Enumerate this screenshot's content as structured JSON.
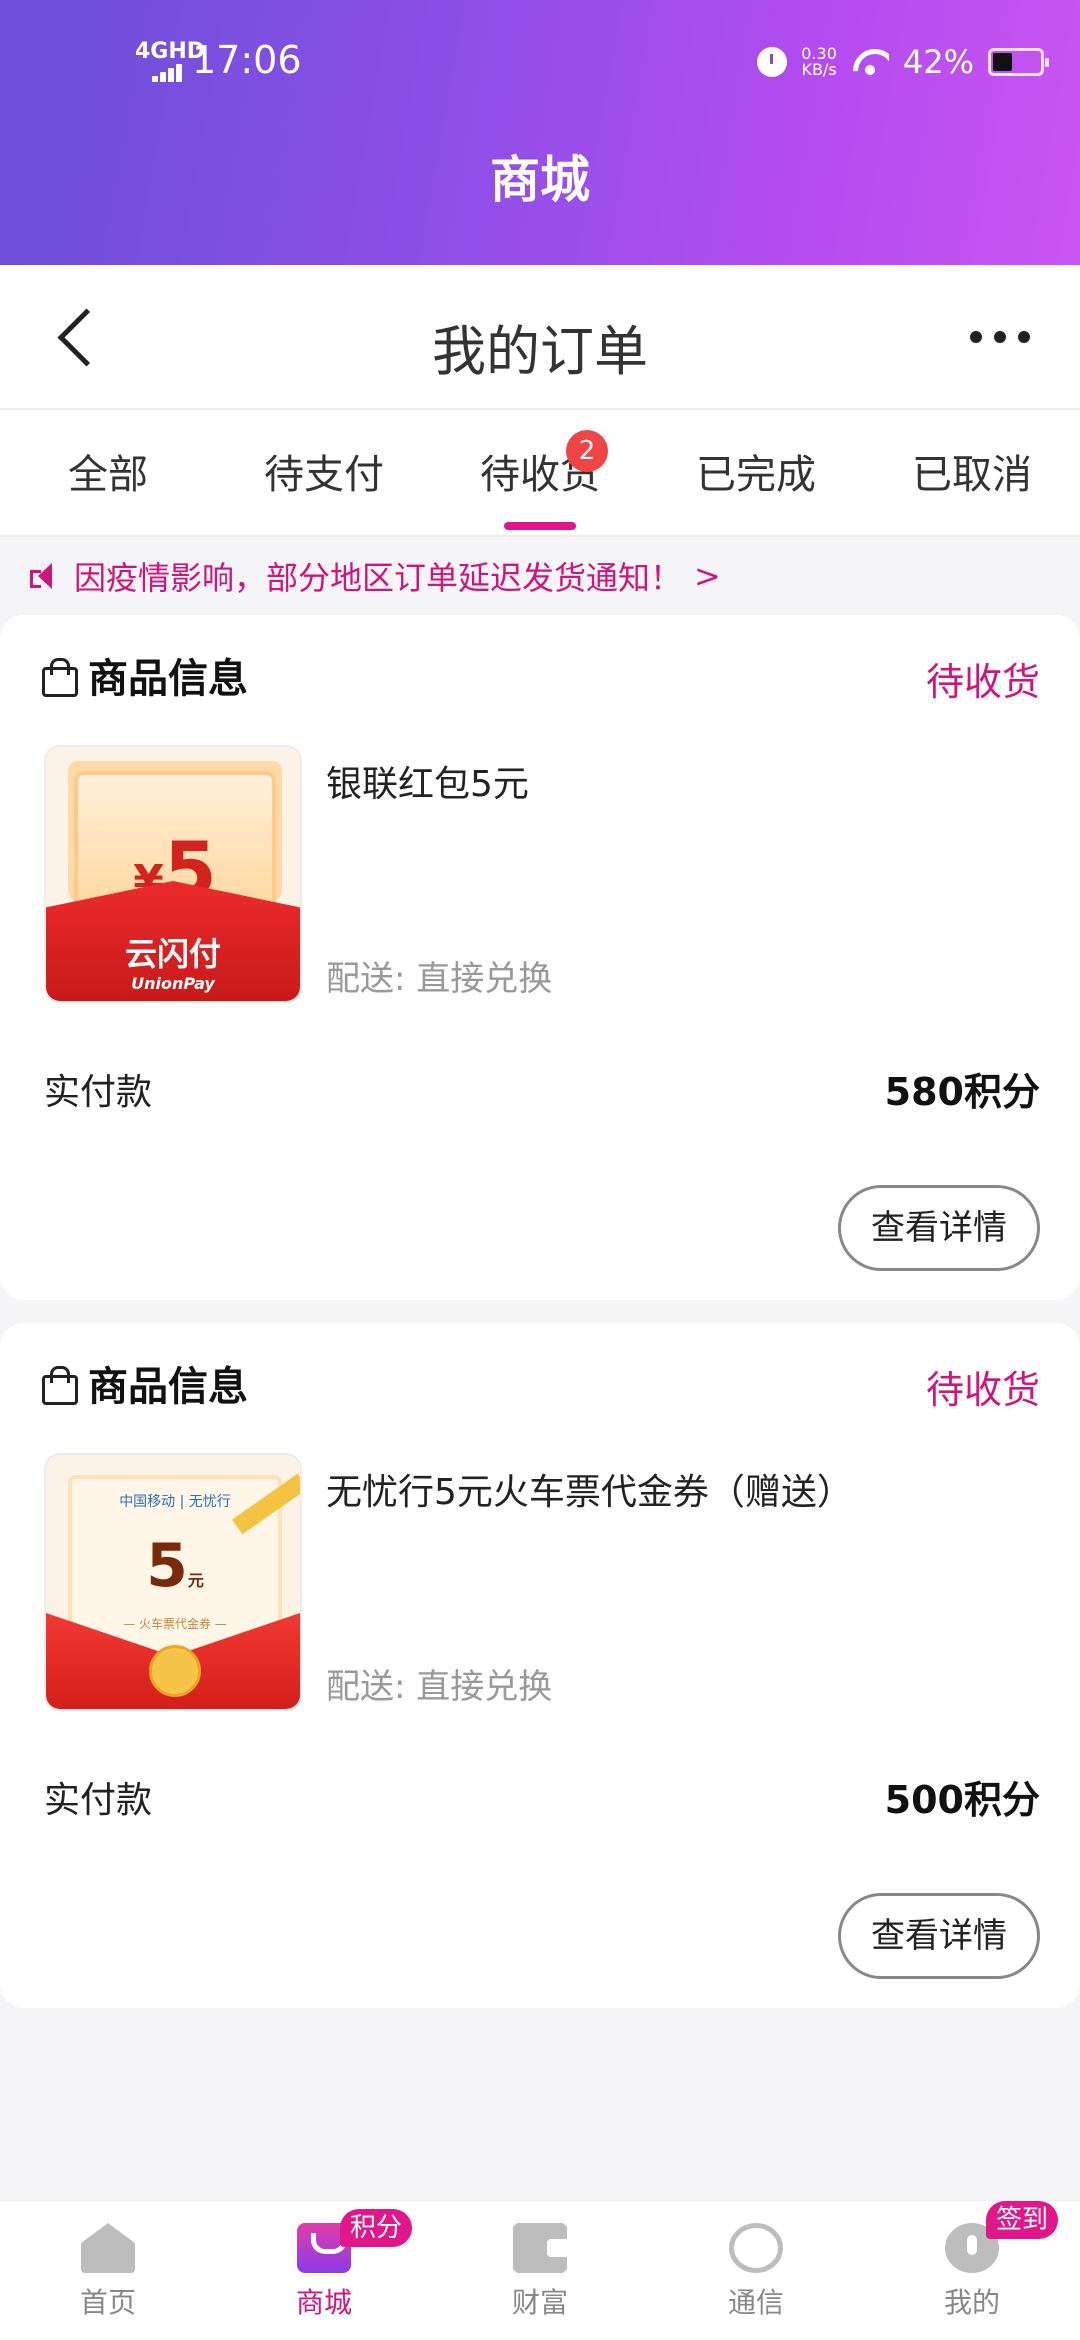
{
  "status_bar": {
    "network": "4GHD",
    "time": "17:06",
    "speed_value": "0.30",
    "speed_unit": "KB/s",
    "battery": "42%",
    "battery_level": 0.42,
    "alarm_icon": "alarm-icon",
    "wifi_icon": "wifi-icon"
  },
  "header": {
    "title": "商城"
  },
  "nav": {
    "title": "我的订单",
    "back_icon": "chevron-left-icon",
    "more_icon": "more-icon"
  },
  "tabs": [
    {
      "label": "全部"
    },
    {
      "label": "待支付"
    },
    {
      "label": "待收货",
      "badge": "2",
      "active": true
    },
    {
      "label": "已完成"
    },
    {
      "label": "已取消"
    }
  ],
  "notice": {
    "text": "因疫情影响，部分地区订单延迟发货通知！",
    "arrow": ">"
  },
  "orders": [
    {
      "section_title": "商品信息",
      "status": "待收货",
      "product_name": "银联红包5元",
      "delivery": "配送: 直接兑换",
      "paid_label": "实付款",
      "paid_value": "580积分",
      "button": "查看详情",
      "thumb": {
        "currency": "¥",
        "amount": "5",
        "brand": "云闪付",
        "brand_sub": "UnionPay"
      }
    },
    {
      "section_title": "商品信息",
      "status": "待收货",
      "product_name": "无忧行5元火车票代金券（赠送）",
      "delivery": "配送: 直接兑换",
      "paid_label": "实付款",
      "paid_value": "500积分",
      "button": "查看详情",
      "thumb": {
        "logos": "中国移动 | 无忧行",
        "amount": "5",
        "unit": "元",
        "caption": "— 火车票代金券 —"
      }
    }
  ],
  "bottom_nav": [
    {
      "label": "首页",
      "icon": "home-icon"
    },
    {
      "label": "商城",
      "icon": "mall-bag-icon",
      "badge": "积分",
      "active": true
    },
    {
      "label": "财富",
      "icon": "wallet-icon"
    },
    {
      "label": "通信",
      "icon": "china-mobile-icon"
    },
    {
      "label": "我的",
      "icon": "profile-icon",
      "badge": "签到"
    }
  ],
  "colors": {
    "accent": "#d0147e",
    "badge_red": "#f04545",
    "header_gradient_start": "#6a4fd8",
    "header_gradient_end": "#c955f2"
  }
}
